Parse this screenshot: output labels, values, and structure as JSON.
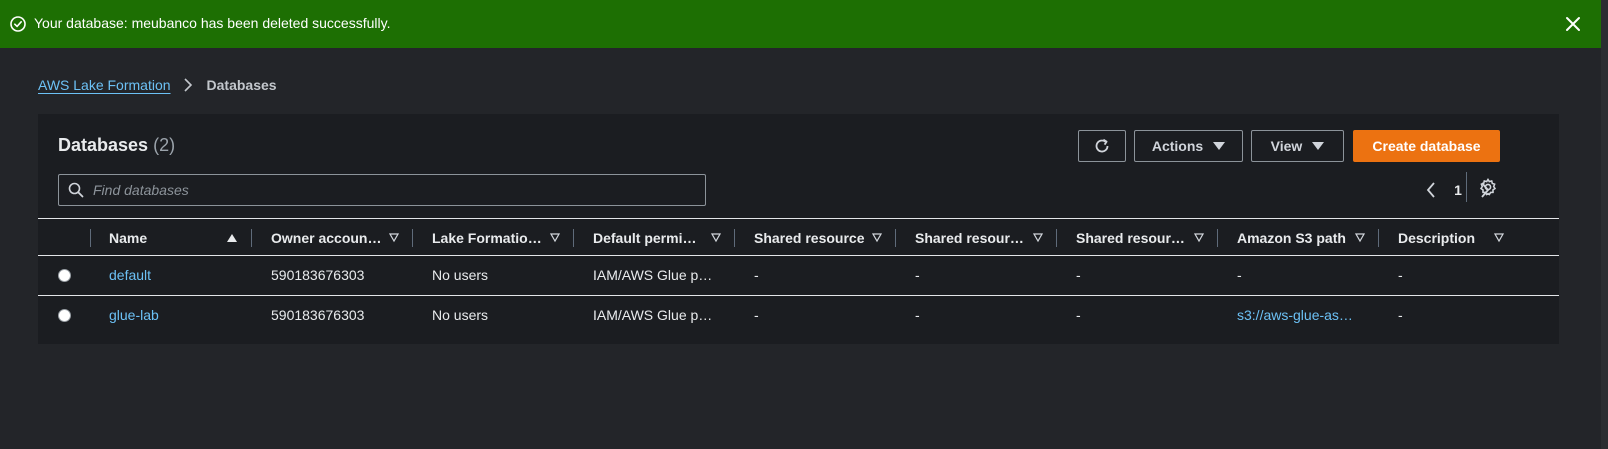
{
  "flash": {
    "message": "Your database: meubanco has been deleted successfully.",
    "type": "success"
  },
  "breadcrumb": {
    "root": "AWS Lake Formation",
    "current": "Databases"
  },
  "panel": {
    "title": "Databases",
    "count": "(2)",
    "buttons": {
      "actions": "Actions",
      "view": "View",
      "create": "Create database"
    },
    "search_placeholder": "Find databases",
    "page": "1"
  },
  "table": {
    "columns": [
      "Name",
      "Owner accoun…",
      "Lake Formatio…",
      "Default permi…",
      "Shared resource",
      "Shared resour…",
      "Shared resour…",
      "Amazon S3 path",
      "Description"
    ],
    "rows": [
      [
        "default",
        "590183676303",
        "No users",
        "IAM/AWS Glue p…",
        "-",
        "-",
        "-",
        "-",
        "-"
      ],
      [
        "glue-lab",
        "590183676303",
        "No users",
        "IAM/AWS Glue p…",
        "-",
        "-",
        "-",
        "s3://aws-glue-as…",
        "-"
      ]
    ]
  },
  "colors": {
    "success_banner": "#1d6f03",
    "primary_button": "#ec7211",
    "link": "#6cc1f5",
    "background": "#232529",
    "panel": "#1b1d21"
  }
}
